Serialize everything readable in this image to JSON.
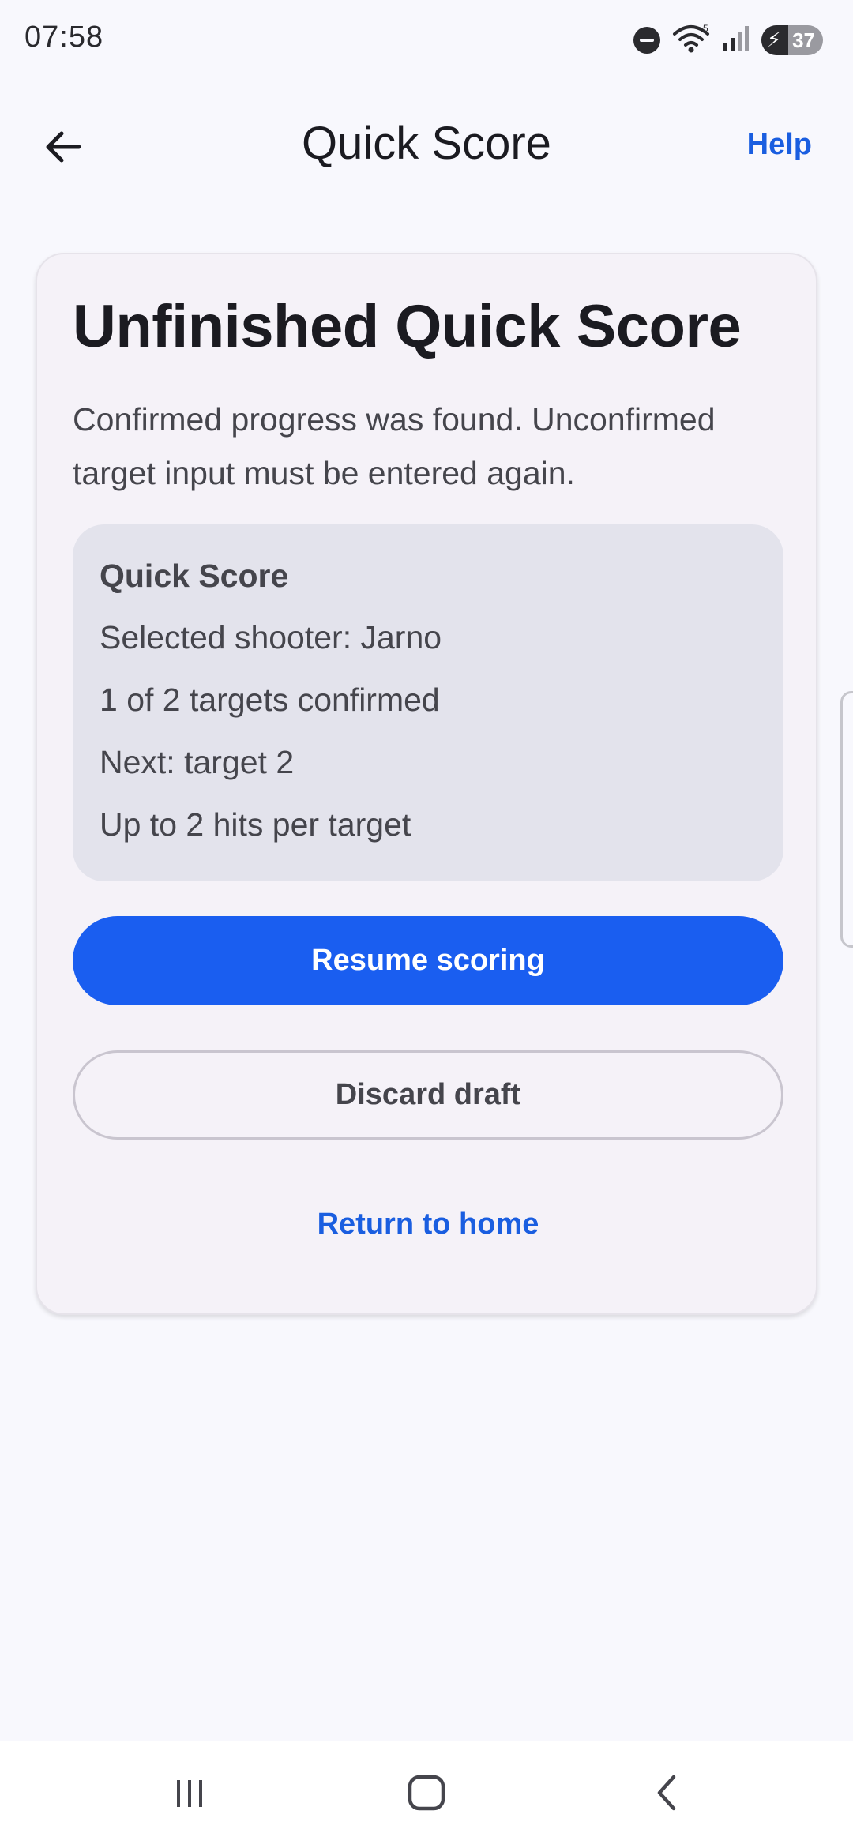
{
  "status_bar": {
    "time": "07:58",
    "battery_level": "37",
    "icons": [
      "do-not-disturb-icon",
      "wifi-icon",
      "signal-icon",
      "battery-charging-icon"
    ]
  },
  "app_bar": {
    "title": "Quick Score",
    "help_label": "Help",
    "back_icon": "arrow-left-icon"
  },
  "card": {
    "title": "Unfinished Quick Score",
    "description": "Confirmed progress was found. Unconfirmed target input must be entered again.",
    "summary": {
      "title": "Quick Score",
      "lines": [
        "Selected shooter: Jarno",
        "1 of 2 targets confirmed",
        "Next: target 2",
        "Up to 2 hits per target"
      ]
    },
    "resume_label": "Resume scoring",
    "discard_label": "Discard draft",
    "return_label": "Return to home"
  },
  "nav_bar": {
    "icons": [
      "recent-apps-icon",
      "home-icon",
      "back-icon"
    ]
  },
  "colors": {
    "accent": "#1a5ef0",
    "link": "#1a5ee0",
    "background": "#f8f8fd",
    "card": "#f5f2f8",
    "summary_box": "#e3e3ec"
  }
}
